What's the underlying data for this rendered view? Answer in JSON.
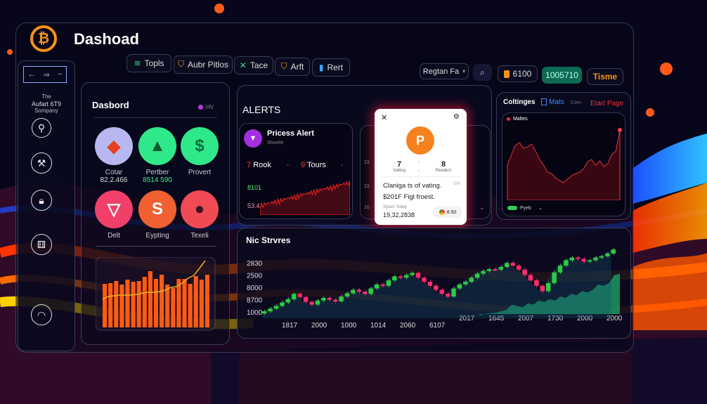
{
  "header": {
    "title": "Dashoad",
    "logo_icon": "bitcoin-icon"
  },
  "sidebar": {
    "nav": [
      "←",
      "⇒",
      "~"
    ],
    "company": [
      "The",
      "Aufart 6T9",
      "Sompany"
    ],
    "icons": [
      "key-icon",
      "tools-icon",
      "lock-icon",
      "dice-icon",
      "gauge-icon"
    ]
  },
  "tabs": [
    {
      "label": "Topls",
      "icon": "wifi-icon",
      "color": "#3ddc84"
    },
    {
      "label": "Aubr Pitlos",
      "icon": "shield-icon",
      "color": "#f5a623"
    },
    {
      "label": "Tace",
      "icon": "x-icon",
      "color": "#3ddc84"
    },
    {
      "label": "Arft",
      "icon": "shield-icon",
      "color": "#f5a623"
    },
    {
      "label": "Rert",
      "icon": "tag-icon",
      "color": "#3ea6ff"
    }
  ],
  "toolbar": {
    "search_value": "Regtan Fa",
    "balance": "6100",
    "green_value": "1005710",
    "theme_label": "Tisme"
  },
  "dashboard": {
    "title": "Dasbord",
    "badge": "HV",
    "tiles": [
      {
        "label": "Cotar",
        "value": "82.2.466",
        "icon": "diamond-icon",
        "bg": "#b8b8f0",
        "fg": "#e8401c"
      },
      {
        "label": "Pertber",
        "value": "8514 590",
        "icon": "warning-icon",
        "bg": "#2ee88a",
        "fg": "#0b5a33"
      },
      {
        "label": "Provert",
        "value": "",
        "icon": "dollar-icon",
        "bg": "#2ee88a",
        "fg": "#0b6a3a"
      },
      {
        "label": "Delt",
        "value": "",
        "icon": "shield-icon",
        "bg": "#f0406a",
        "fg": "#fff"
      },
      {
        "label": "Eypting",
        "value": "",
        "icon": "coin-icon",
        "bg": "#f06030",
        "fg": "#fff"
      },
      {
        "label": "Texeli",
        "value": "",
        "icon": "user-icon",
        "bg": "#f04a55",
        "fg": "#3a1520"
      }
    ],
    "bar_chart": {
      "type": "bar",
      "values": [
        62,
        63,
        66,
        61,
        68,
        65,
        66,
        72,
        80,
        69,
        75,
        61,
        56,
        69,
        69,
        62,
        73,
        68,
        75
      ],
      "line": [
        40,
        44,
        45,
        46,
        46,
        46,
        47,
        49,
        50,
        50,
        51,
        53,
        57,
        58,
        63,
        70,
        74,
        84,
        95
      ],
      "ylim": [
        0,
        100
      ]
    }
  },
  "alerts": {
    "title": "ALERTS",
    "card": {
      "title": "Pricess Alert",
      "subtitle": "Stovele",
      "select1": "Rook",
      "select1_num": "7",
      "select2": "Tours",
      "select2_num": "9",
      "value_top": "8101",
      "value_bottom": "53.4"
    },
    "popup": {
      "num_left": "7",
      "label_left": "Vaiting",
      "num_right": "8",
      "label_right": "Reedect",
      "text1": "Claniga ts of vating.",
      "text1_tag": "GM",
      "text2": "$201F Figl froest.",
      "foot_label": "Syson Tolaty",
      "foot_value": "19,32,2838",
      "chip": "8.50"
    },
    "side_ticks": [
      "23",
      "23",
      "10"
    ]
  },
  "settings": {
    "tabs": [
      "Coltinges",
      "Mats",
      "Com",
      "Etart Page"
    ],
    "chart_title": "Maltes",
    "toggle_label": "Pyeb",
    "line": [
      40,
      55,
      68,
      72,
      64,
      66,
      70,
      60,
      48,
      40,
      30,
      28,
      22,
      18,
      15,
      20,
      25,
      28,
      30,
      35,
      45,
      48,
      40,
      46,
      38,
      42,
      55,
      60,
      90
    ]
  },
  "chart_data": {
    "type": "candlestick",
    "title": "Nic Strvres",
    "yticks": [
      "2830",
      "2500",
      "8000",
      "8700",
      "1000"
    ],
    "xticks": [
      "1817",
      "2000",
      "1000",
      "1014",
      "2060",
      "6107",
      "2017",
      "1645",
      "2007",
      "1730",
      "2000",
      "2000"
    ],
    "closes": [
      1050,
      1150,
      1250,
      1380,
      1500,
      1700,
      1580,
      1400,
      1300,
      1450,
      1550,
      1480,
      1420,
      1600,
      1720,
      1850,
      1780,
      1700,
      1900,
      2050,
      2000,
      2200,
      2350,
      2300,
      2400,
      2480,
      2300,
      2150,
      2000,
      1850,
      1700,
      1600,
      1900,
      2050,
      2150,
      2300,
      2450,
      2550,
      2620,
      2600,
      2700,
      2850,
      2750,
      2600,
      2400,
      2200,
      2000,
      1800,
      2100,
      2500,
      2750,
      2950,
      3050,
      3000,
      2900,
      2950,
      3050,
      3100,
      3200,
      3350
    ],
    "area": [
      900,
      950,
      980,
      1000,
      1050,
      1100,
      1300,
      1250,
      1200,
      1350,
      1300,
      1450,
      1400,
      1500,
      1450,
      1600,
      1550,
      1700,
      1650,
      1800,
      1750,
      1850,
      2050,
      2000,
      2100,
      2400,
      2450
    ]
  },
  "colors": {
    "up": "#2ecc40",
    "down": "#ff2d6f",
    "accent": "#f7931a"
  }
}
